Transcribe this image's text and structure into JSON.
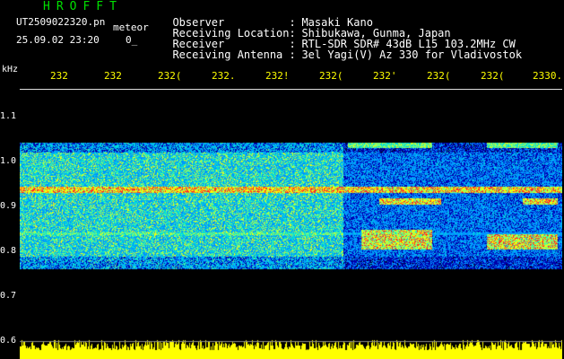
{
  "header": {
    "brand": "HROFFT",
    "filename": "UT2509022320.pn",
    "mode": "meteor",
    "datetime": "25.09.02 23:20",
    "count": "0_"
  },
  "info": [
    {
      "key": "Observer",
      "value": "Masaki Kano"
    },
    {
      "key": "Receiving Location",
      "value": "Shibukawa, Gunma, Japan"
    },
    {
      "key": "Receiver",
      "value": "RTL-SDR SDR# 43dB L15 103.2MHz CW"
    },
    {
      "key": "Receiving Antenna",
      "value": "3el Yagi(V) Az 330 for Vladivostok"
    }
  ],
  "axis": {
    "y_unit": "kHz",
    "y_ticks": [
      "1.1",
      "1.0",
      "0.9",
      "0.8",
      "0.7",
      "0.6"
    ],
    "x_ticks": [
      "232",
      "232",
      "232(",
      "232.",
      "232!",
      "232(",
      "232'",
      "232(",
      "232(",
      "2330."
    ]
  },
  "colors": {
    "brand": "#00e000",
    "text": "#ffffff",
    "xlabel": "#ffff00",
    "background": "#000000",
    "signal_strip": "#ffff00"
  }
}
